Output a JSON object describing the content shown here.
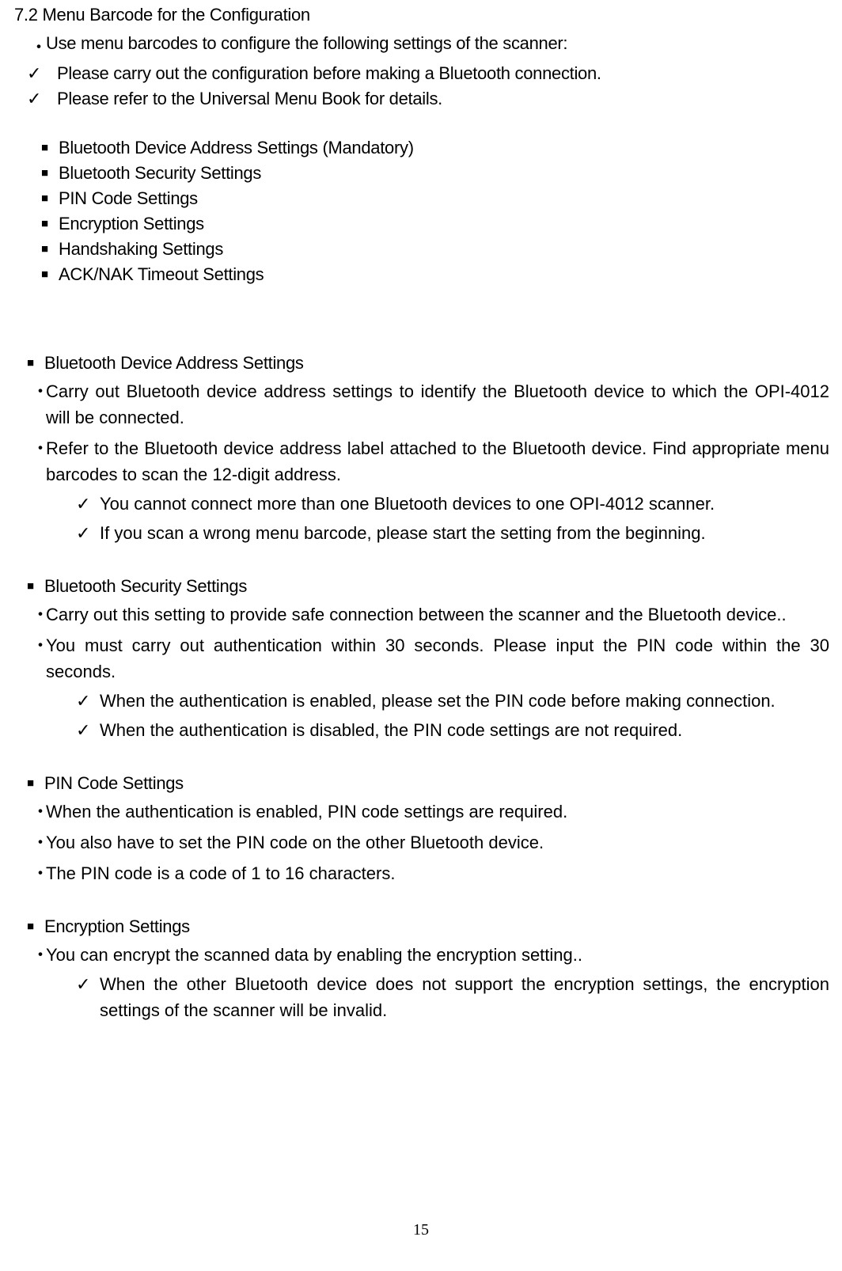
{
  "section_title": "7.2 Menu Barcode for the Configuration",
  "intro_dot": "Use menu barcodes to configure the following settings of the scanner:",
  "intro_checks": [
    "Please carry out the configuration before making a Bluetooth connection.",
    "Please refer to the Universal Menu Book for details."
  ],
  "toc_items": [
    "Bluetooth Device Address Settings (Mandatory)",
    "Bluetooth Security Settings",
    "PIN Code Settings",
    "Encryption Settings",
    "Handshaking Settings",
    "ACK/NAK Timeout Settings"
  ],
  "sections": {
    "bdas": {
      "title": "Bluetooth Device Address Settings",
      "dots": [
        "Carry out Bluetooth device address settings to identify the Bluetooth device to which the OPI-4012 will be connected.",
        "Refer to the Bluetooth device address label attached to the Bluetooth device. Find appropriate menu barcodes to scan the 12-digit address."
      ],
      "checks": [
        "You cannot connect more than one Bluetooth devices to one OPI-4012 scanner.",
        "If you scan a wrong menu barcode, please start the setting from the beginning."
      ]
    },
    "bss": {
      "title": "Bluetooth Security Settings",
      "dots": [
        "Carry out this setting to provide safe connection between the scanner and the Bluetooth device..",
        "You must carry out authentication within 30 seconds. Please input the PIN code within the 30 seconds."
      ],
      "checks": [
        "When the authentication is enabled, please set the PIN code before making connection.",
        "When the authentication is disabled, the PIN code settings are not required."
      ]
    },
    "pin": {
      "title": "PIN Code Settings",
      "dots": [
        "When the authentication is enabled, PIN code settings are required.",
        "You also have to set the PIN code on the other Bluetooth device.",
        "The PIN code is a code of 1 to 16 characters."
      ]
    },
    "enc": {
      "title": "Encryption Settings",
      "dots": [
        "You can encrypt the scanned data by enabling the encryption setting.."
      ],
      "checks": [
        "When the other Bluetooth device does not support the encryption settings, the encryption settings of the scanner will be invalid."
      ]
    }
  },
  "page_number": "15"
}
